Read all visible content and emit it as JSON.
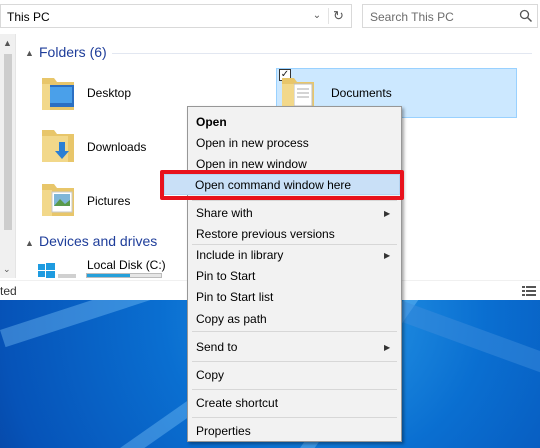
{
  "address_bar": {
    "path": "This PC",
    "dropdown_icon": "chevron-down-icon",
    "refresh_icon": "refresh-icon"
  },
  "search": {
    "placeholder": "Search This PC",
    "icon": "search-icon"
  },
  "sections": {
    "folders": {
      "title": "Folders (6)"
    },
    "devices": {
      "title": "Devices and drives"
    }
  },
  "folders": [
    {
      "label": "Desktop",
      "icon": "desktop-folder-icon"
    },
    {
      "label": "Downloads",
      "icon": "downloads-folder-icon"
    },
    {
      "label": "Pictures",
      "icon": "pictures-folder-icon"
    },
    {
      "label": "Documents",
      "icon": "documents-folder-icon",
      "selected": true
    }
  ],
  "drives": [
    {
      "label": "Local Disk (C:)",
      "icon": "windows-drive-icon",
      "used_fraction": 0.58
    }
  ],
  "status": {
    "text": "ted"
  },
  "context_menu": {
    "items": [
      {
        "label": "Open",
        "bold": true
      },
      {
        "label": "Open in new process"
      },
      {
        "label": "Open in new window"
      },
      {
        "label": "Open command window here",
        "highlighted": true
      },
      {
        "label": "Share with",
        "submenu": true
      },
      {
        "label": "Restore previous versions"
      },
      {
        "label": "Include in library",
        "submenu": true
      },
      {
        "label": "Pin to Start"
      },
      {
        "label": "Pin to Start list"
      },
      {
        "label": "Copy as path"
      },
      {
        "label": "Send to",
        "submenu": true
      },
      {
        "label": "Copy"
      },
      {
        "label": "Create shortcut"
      },
      {
        "label": "Properties"
      }
    ]
  },
  "colors": {
    "highlight_box": "#e8121c",
    "selection": "#cce8ff",
    "section_header": "#1e3d9a",
    "desktop": "#0a6fd1"
  }
}
